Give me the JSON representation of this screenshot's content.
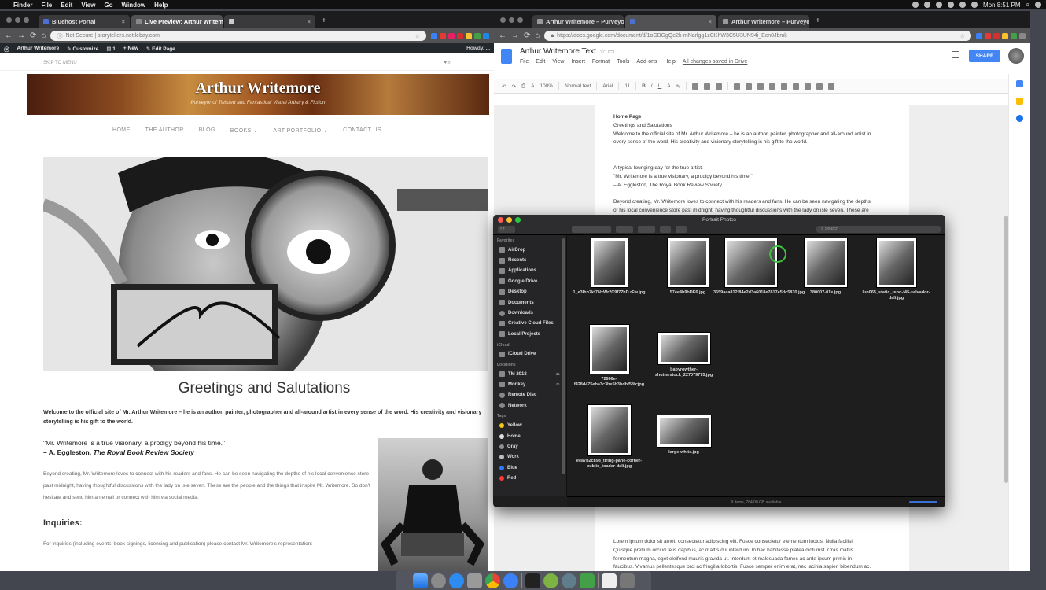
{
  "menubar": {
    "app": "Finder",
    "items": [
      "File",
      "Edit",
      "View",
      "Go",
      "Window",
      "Help"
    ],
    "clock": "Mon 8:51 PM"
  },
  "left_browser": {
    "tabs": [
      {
        "label": "Bluehost Portal"
      },
      {
        "label": "Live Preview: Arthur Writemo"
      },
      {
        "label": ""
      }
    ],
    "url": "Not Secure | storytellers.nettlebay.com"
  },
  "wpbar": {
    "site": "Arthur Writemore",
    "customize": "Customize",
    "comments": "1",
    "new": "+ New",
    "edit": "Edit Page",
    "howdy": "Howdy, ..."
  },
  "site": {
    "skip": "SKIP TO MENU",
    "title": "Arthur Writemore",
    "tagline": "Purveyor of Twisted and Fantastical Visual Artistry & Fiction",
    "nav": [
      "HOME",
      "THE AUTHOR",
      "BLOG",
      "BOOKS ⌄",
      "ART PORTFOLIO ⌄",
      "CONTACT US"
    ],
    "heading": "Greetings and Salutations",
    "welcome": "Welcome to the official site of Mr. Arthur Writemore – he is an author, painter, photographer and all-around artist in every sense of the word. His creativity and visionary storytelling is his gift to the world.",
    "quote": "\"Mr. Writemore is a true visionary, a prodigy beyond his time.\"",
    "attribution_name": "– A. Eggleston, ",
    "attribution_pub": "The Royal Book Review Society",
    "paragraph": "Beyond creating, Mr. Writemore loves to connect with his readers and fans. He can be seen navigating the depths of his local convenience store past midnight, having thoughtful discussions with the lady on isle seven. These are the people and the things that inspire Mr. Writemore. So don't hesitate and send him an email or connect with him via social media.",
    "inquiries_heading": "Inquiries:",
    "inquiries_text": "For inquiries (including events, book signings, licensing and publication) please contact Mr. Writemore's representation:"
  },
  "right_browser": {
    "tabs": [
      {
        "label": "Arthur Writemore – Purveyor"
      },
      {
        "label": ""
      },
      {
        "label": "Arthur Writemore – Purveyor"
      }
    ],
    "url": "https://docs.google.com/document/d/1oGBGgQe2k-mNarlgg1zCKhW3C5U3UN94i_Ecn0Jbmk"
  },
  "docs": {
    "title": "Arthur Writemore Text",
    "menus": [
      "File",
      "Edit",
      "View",
      "Insert",
      "Format",
      "Tools",
      "Add-ons",
      "Help"
    ],
    "saved": "All changes saved in Drive",
    "share": "SHARE",
    "toolbar": {
      "zoom": "100%",
      "style": "Normal text",
      "font": "Arial",
      "size": "11"
    },
    "body": [
      "Home Page",
      "Greetings and Salutations",
      "Welcome to the official site of Mr. Arthur Writemore – he is an author, painter, photographer and all-around artist in every sense of the word. His creativity and visionary storytelling is his gift to the world.",
      "A typical lounging day for the true artist.",
      "\"Mr. Writemore is a true visionary, a prodigy beyond his time.\"",
      "– A. Eggleston, The Royal Book Review Society",
      "Beyond creating, Mr. Writemore loves to connect with his readers and fans. He can be seen navigating the depths of his local convenience store past midnight, having thoughtful discussions with the lady on isle seven. These are the people and the things that inspire Mr."
    ],
    "lorem": "Lorem ipsum dolor sit amet, consectetur adipiscing elit. Fusce consectetur elementum luctus. Nulla facilisi. Quisque pretium orci id felis dapibus, ac mattis dui interdum. In hac habitasse platea dictumst. Cras mattis fermentum magna, eget eleifend mauris gravida ut. Interdum et malesuada fames ac ante ipsum primis in faucibus. Vivamus pellentesque orci ac fringilla lobortis. Fusce semper enim erat, nec lacinia sapien bibendum ac. Aliquam commodo sit amet"
  },
  "finder": {
    "title": "Portrait Photos",
    "search_placeholder": "Search",
    "sidebar": {
      "favorites_label": "Favorites",
      "favorites": [
        "AirDrop",
        "Recents",
        "Applications",
        "Google Drive",
        "Desktop",
        "Documents",
        "Downloads",
        "Creative Cloud Files",
        "Local Projects"
      ],
      "icloud_label": "iCloud",
      "icloud": [
        "iCloud Drive"
      ],
      "locations_label": "Locations",
      "locations": [
        "TM 2018",
        "Monkey",
        "Remote Disc",
        "Network"
      ],
      "tags_label": "Tags",
      "tags": [
        {
          "name": "Yellow",
          "color": "#f5c518"
        },
        {
          "name": "Home",
          "color": "#dddddd"
        },
        {
          "name": "Gray",
          "color": "#8e8e93"
        },
        {
          "name": "Work",
          "color": "#bdbdbd"
        },
        {
          "name": "Blue",
          "color": "#2f7bf6"
        },
        {
          "name": "Red",
          "color": "#ff3b30"
        }
      ]
    },
    "files": [
      {
        "name": "1_e3Ihh7kf7NxWr2C9f77hD rFw.jpg"
      },
      {
        "name": "57ee4b9bDE6.jpg"
      },
      {
        "name": "3559aaa812f84e2d3a6018e7617e5dc5830.jpg"
      },
      {
        "name": "380007-01e.jpg"
      },
      {
        "name": "lun065_static_repo-f45-salvador-dali.jpg"
      },
      {
        "name": "72866e-f428d475eba3c3be5b3bdbf58fcjpg"
      },
      {
        "name": "babyrowther-shutterstock_227079775.jpg"
      },
      {
        "name": "eea7b2c898_tiring-pane-corner-public_toader-dali.jpg"
      },
      {
        "name": "large-white.jpg"
      }
    ],
    "status": "9 items, 784.00 GB available"
  }
}
